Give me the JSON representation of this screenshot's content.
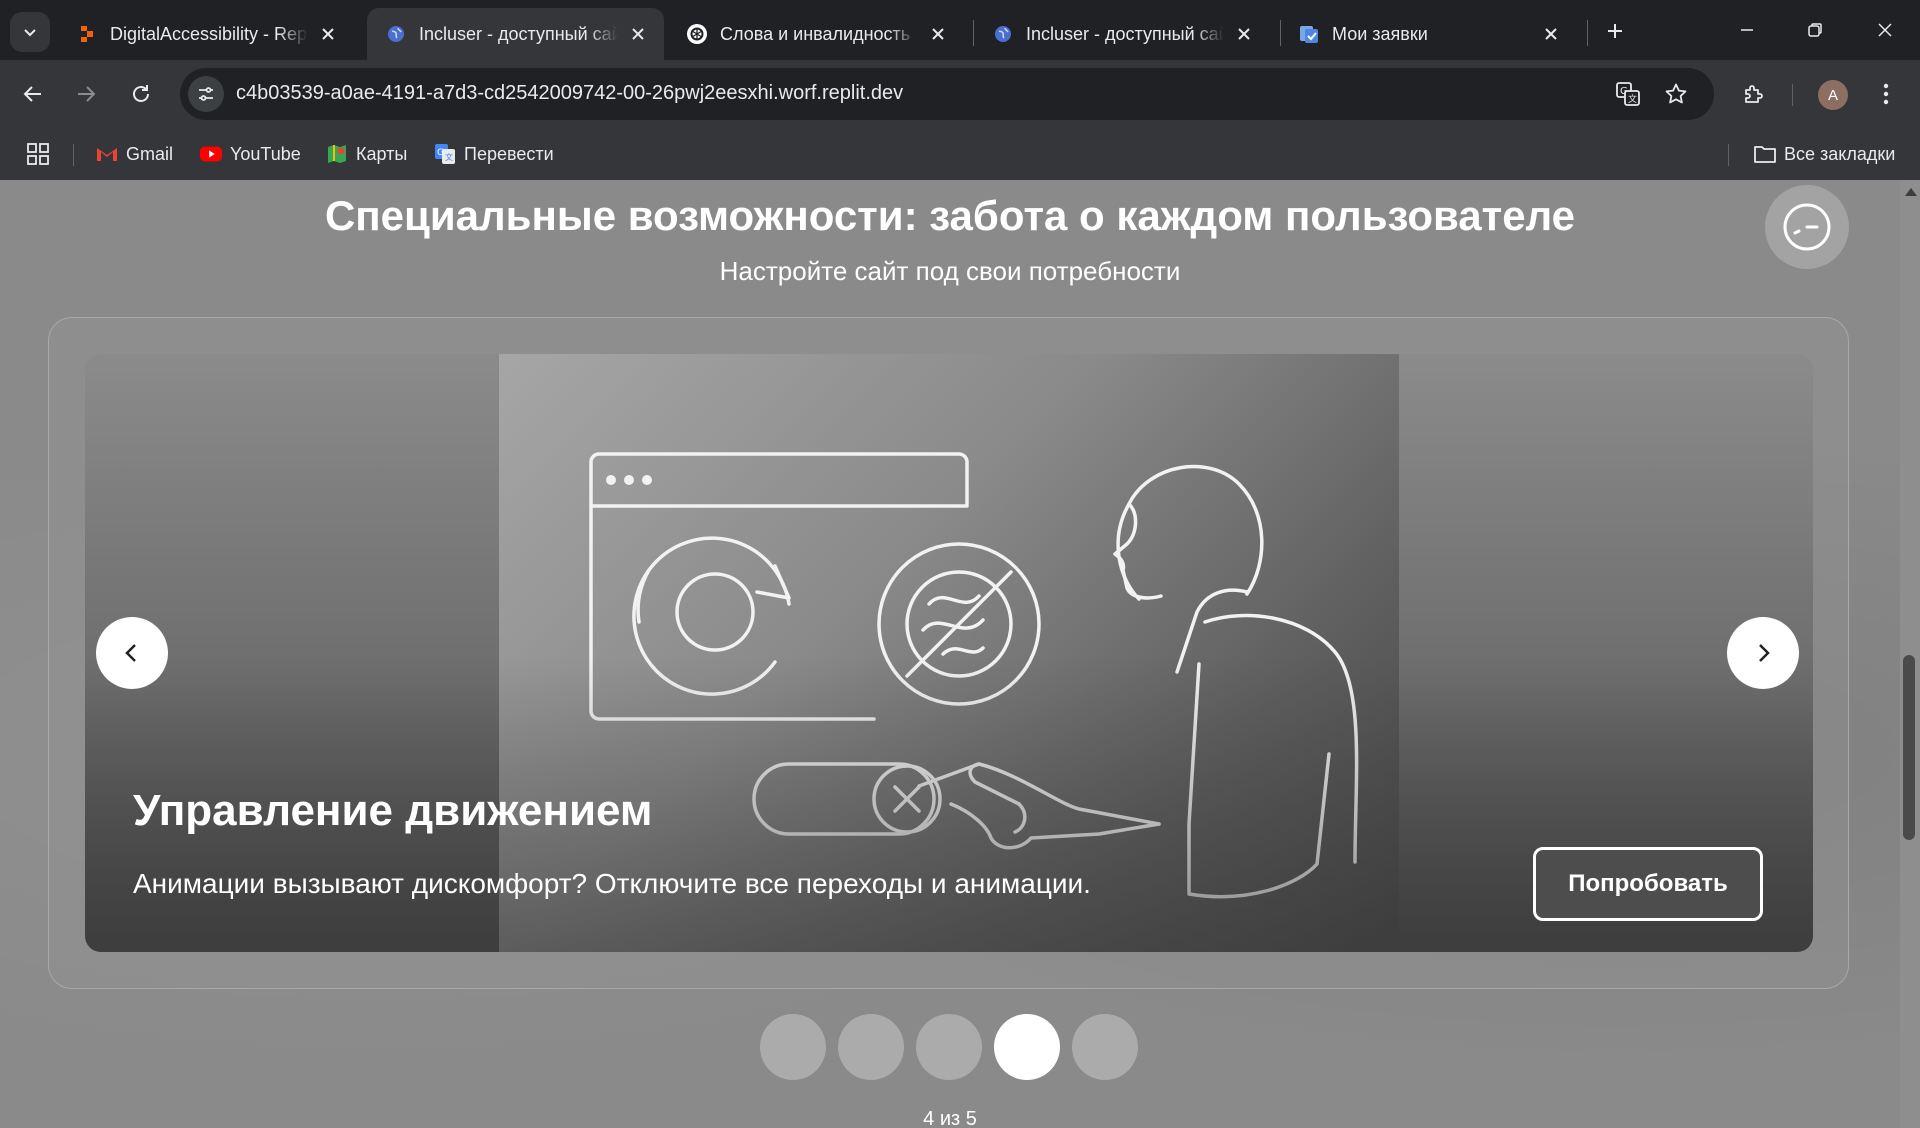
{
  "browser": {
    "tabs": [
      {
        "title": "DigitalAccessibility - Repl",
        "favicon": "replit-icon",
        "active": false
      },
      {
        "title": "Incluser - доступный сай",
        "favicon": "globe-icon",
        "active": true
      },
      {
        "title": "Слова и инвалидность",
        "favicon": "chatgpt-icon",
        "active": false
      },
      {
        "title": "Incluser - доступный сай",
        "favicon": "globe-icon",
        "active": false
      },
      {
        "title": "Мои заявки",
        "favicon": "tasks-icon",
        "active": false
      }
    ],
    "url": "c4b03539-a0ae-4191-a7d3-cd2542009742-00-26pwj2eesxhi.worf.replit.dev",
    "avatar_letter": "A",
    "bookmarks": [
      {
        "label": "Gmail",
        "icon": "gmail-icon"
      },
      {
        "label": "YouTube",
        "icon": "youtube-icon"
      },
      {
        "label": "Карты",
        "icon": "maps-icon"
      },
      {
        "label": "Перевести",
        "icon": "translate-icon"
      }
    ],
    "all_bookmarks_label": "Все закладки"
  },
  "page": {
    "title": "Специальные возможности: забота о каждом пользователе",
    "subtitle": "Настройте сайт под свои потребности",
    "slide": {
      "heading": "Управление движением",
      "text": "Анимации вызывают дискомфорт? Отключите все переходы и анимации.",
      "button_label": "Попробовать"
    },
    "pagination": {
      "current": 4,
      "total": 5,
      "counter_text": "4 из 5"
    }
  },
  "colors": {
    "browser_dark": "#202124",
    "browser_toolbar": "#35363a",
    "page_bg": "#8a8a8a",
    "active_dot": "#ffffff",
    "inactive_dot": "#ababab"
  }
}
